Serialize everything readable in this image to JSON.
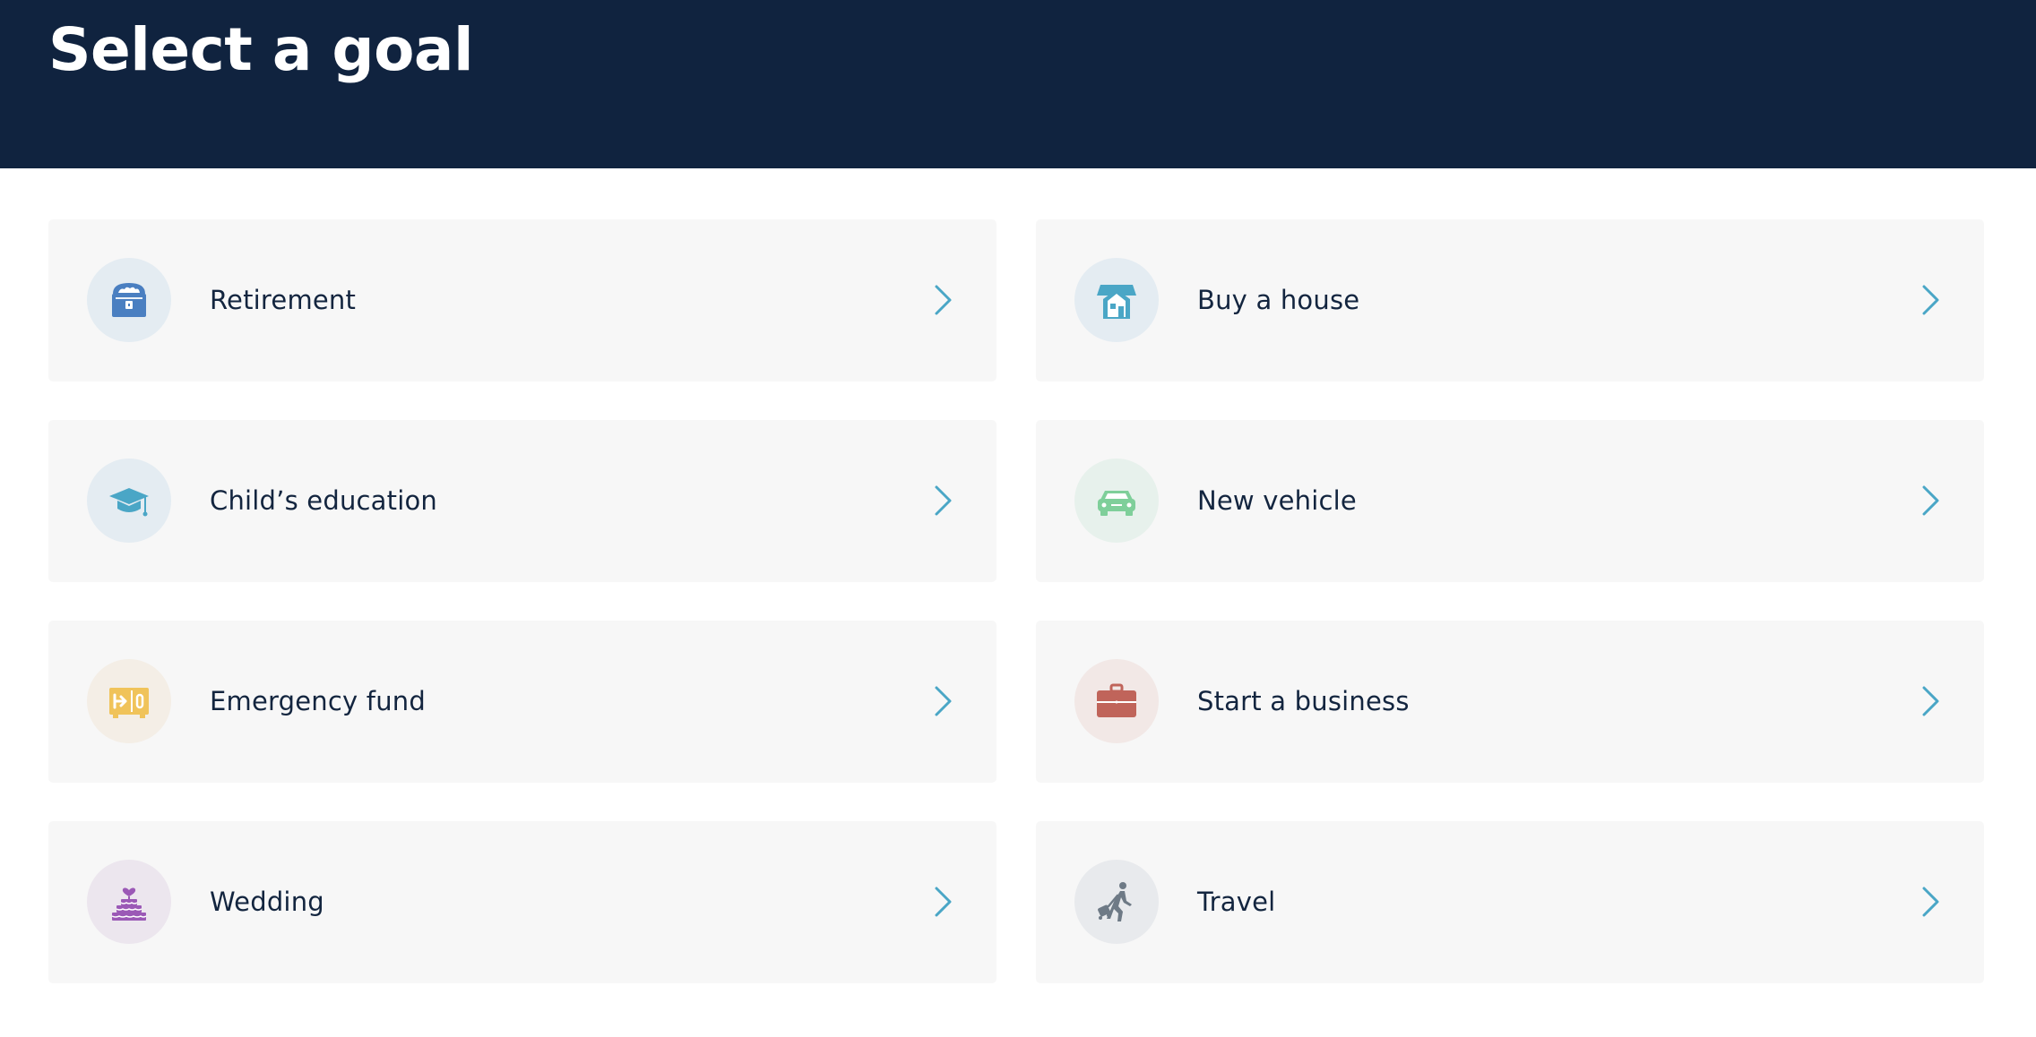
{
  "header": {
    "title": "Select a goal"
  },
  "goals": [
    {
      "label": "Retirement",
      "icon": "treasure-chest-icon",
      "icon_color": "#4a7fc1",
      "circle_color": "#e4ecf2"
    },
    {
      "label": "Buy a house",
      "icon": "house-icon",
      "icon_color": "#4aa6c6",
      "circle_color": "#e4ecf2"
    },
    {
      "label": "Child’s education",
      "icon": "graduation-cap-icon",
      "icon_color": "#4aa6c6",
      "circle_color": "#e4ecf2"
    },
    {
      "label": "New vehicle",
      "icon": "car-icon",
      "icon_color": "#7fcf9a",
      "circle_color": "#e7f1ec"
    },
    {
      "label": "Emergency fund",
      "icon": "safe-icon",
      "icon_color": "#f0c35a",
      "circle_color": "#f4eee6"
    },
    {
      "label": "Start a business",
      "icon": "briefcase-icon",
      "icon_color": "#c0645a",
      "circle_color": "#f2e8e6"
    },
    {
      "label": "Wedding",
      "icon": "wedding-cake-icon",
      "icon_color": "#9b59b6",
      "circle_color": "#ece6ee"
    },
    {
      "label": "Travel",
      "icon": "traveler-icon",
      "icon_color": "#6e7a86",
      "circle_color": "#e8eaed"
    }
  ],
  "chevron_color": "#4aa6c6"
}
